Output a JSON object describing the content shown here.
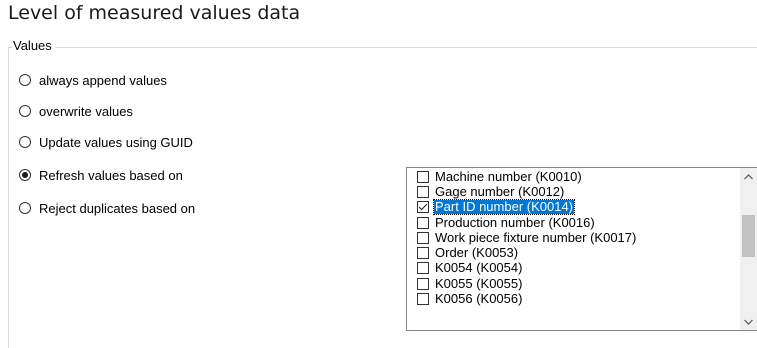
{
  "page": {
    "title": "Level of measured values data"
  },
  "values_group": {
    "label": "Values",
    "options": [
      {
        "label": "always append values",
        "checked": false
      },
      {
        "label": "overwrite values",
        "checked": false
      },
      {
        "label": "Update values using GUID",
        "checked": false
      },
      {
        "label": "Refresh values based on",
        "checked": true
      },
      {
        "label": "Reject duplicates based on",
        "checked": false
      }
    ]
  },
  "key_list": {
    "items": [
      {
        "label": "Machine number (K0010)",
        "checked": false,
        "selected": false
      },
      {
        "label": "Gage number (K0012)",
        "checked": false,
        "selected": false
      },
      {
        "label": "Part ID number (K0014)",
        "checked": true,
        "selected": true
      },
      {
        "label": "Production number (K0016)",
        "checked": false,
        "selected": false
      },
      {
        "label": "Work piece fixture number (K0017)",
        "checked": false,
        "selected": false
      },
      {
        "label": "Order (K0053)",
        "checked": false,
        "selected": false
      },
      {
        "label": "K0054 (K0054)",
        "checked": false,
        "selected": false
      },
      {
        "label": "K0055 (K0055)",
        "checked": false,
        "selected": false
      },
      {
        "label": "K0056 (K0056)",
        "checked": false,
        "selected": false
      }
    ],
    "scrollbar": {
      "up_icon": "chevron-up-icon",
      "down_icon": "chevron-down-icon"
    }
  },
  "colors": {
    "selection": "#0078d7",
    "border": "#828790",
    "scroll_track": "#f0f0f0",
    "scroll_thumb": "#c2c2c2"
  }
}
